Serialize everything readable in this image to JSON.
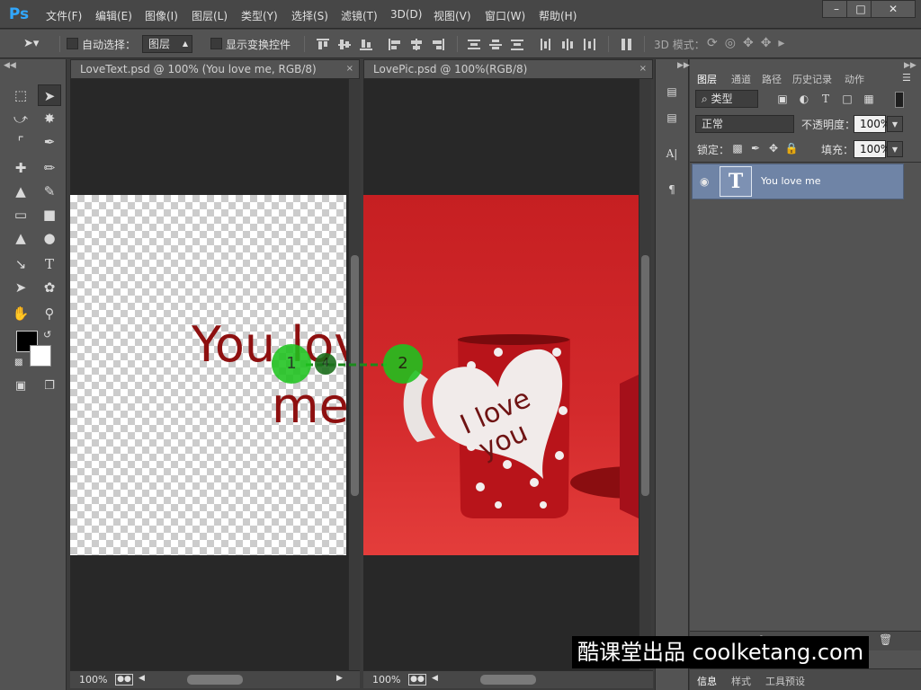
{
  "app": {
    "logo": "Ps",
    "menu": [
      "文件(F)",
      "编辑(E)",
      "图像(I)",
      "图层(L)",
      "类型(Y)",
      "选择(S)",
      "滤镜(T)",
      "3D(D)",
      "视图(V)",
      "窗口(W)",
      "帮助(H)"
    ],
    "window_controls": {
      "minimize": "–",
      "maximize": "□",
      "close": "✕"
    }
  },
  "options": {
    "auto_select_label": "自动选择：",
    "auto_select_value": "图层",
    "show_transform_label": "显示变换控件",
    "mode_3d_label": "3D 模式："
  },
  "documents": [
    {
      "tab": "LoveText.psd @ 100% (You love me, RGB/8)",
      "close": "×",
      "zoom": "100%",
      "canvas_text": [
        "You love",
        "me"
      ]
    },
    {
      "tab": "LovePic.psd @ 100%(RGB/8)",
      "close": "×",
      "zoom": "100%",
      "heart_text": [
        "I love",
        "you"
      ]
    }
  ],
  "drag_annotation": {
    "start": "1",
    "end": "2",
    "hops": "4"
  },
  "layers_panel": {
    "tabs": [
      "图层",
      "通道",
      "路径",
      "历史记录",
      "动作"
    ],
    "filter_label": "⌕ 类型",
    "blend_mode": "正常",
    "opacity_label": "不透明度：",
    "opacity_value": "100%",
    "lock_label": "锁定：",
    "fill_label": "填充：",
    "fill_value": "100%",
    "layer": {
      "name": "You love me",
      "thumb": "T"
    },
    "bottom_tabs": [
      "信息",
      "样式",
      "工具预设"
    ]
  },
  "watermark": "酷课堂出品 coolketang.com",
  "colors": {
    "accent": "#31a8ff",
    "selected_layer": "#6f84a6",
    "marker": "#1ec31e",
    "text_red": "#8e1010"
  }
}
